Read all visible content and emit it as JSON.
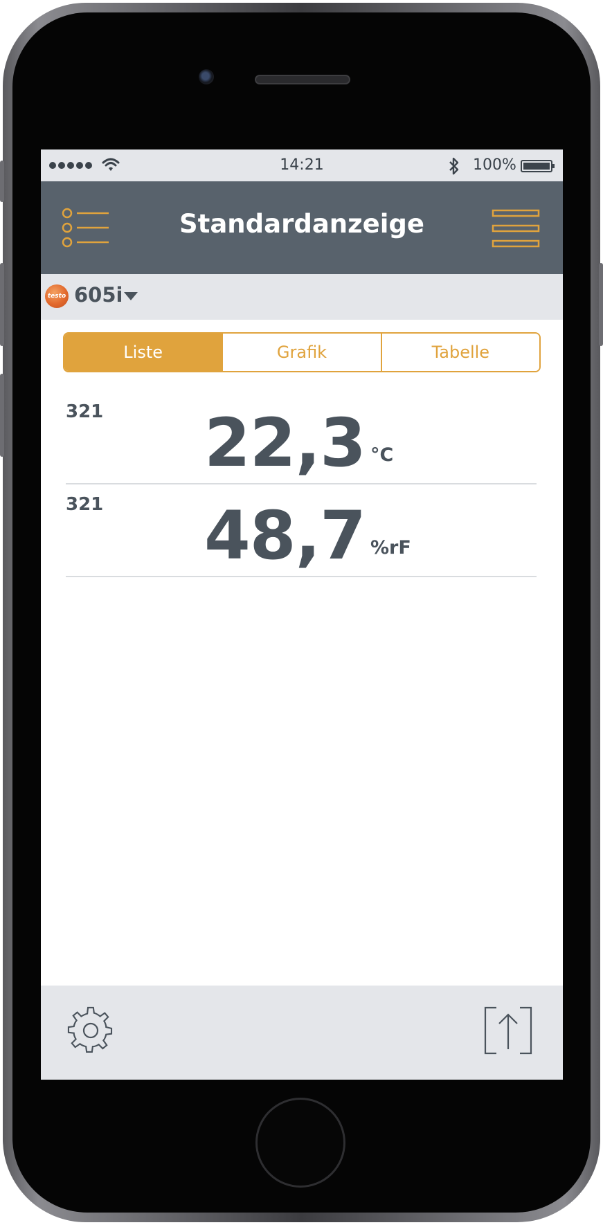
{
  "status_bar": {
    "time": "14:21",
    "battery_percent": "100%",
    "signal_bars": 5,
    "icons": [
      "signal-dots",
      "wifi-icon",
      "bluetooth-icon",
      "battery-icon"
    ]
  },
  "nav": {
    "title": "Standardanzeige",
    "left_icon": "list-icon",
    "right_icon": "menu-icon"
  },
  "device": {
    "brand_logo": "testo",
    "name": "605i"
  },
  "tabs": [
    {
      "label": "Liste",
      "active": true
    },
    {
      "label": "Grafik",
      "active": false
    },
    {
      "label": "Tabelle",
      "active": false
    }
  ],
  "readings": [
    {
      "probe": "321",
      "value": "22,3",
      "unit": "°C"
    },
    {
      "probe": "321",
      "value": "48,7",
      "unit": "%rF"
    }
  ],
  "toolbar": {
    "left_icon": "gear-icon",
    "right_icon": "export-icon"
  },
  "colors": {
    "accent": "#e0a33d",
    "navbar": "#58626c",
    "text_dark": "#4a535c",
    "panel_bg": "#e4e6ea"
  }
}
